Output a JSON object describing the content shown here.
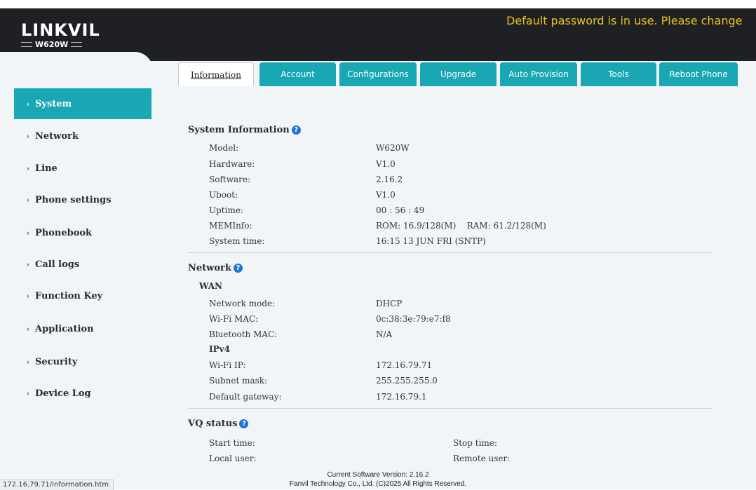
{
  "header": {
    "logo": "LINKVIL",
    "model": "W620W",
    "warning": "Default password is in use. Please change"
  },
  "tabs": [
    "Information",
    "Account",
    "Configurations",
    "Upgrade",
    "Auto Provision",
    "Tools",
    "Reboot Phone"
  ],
  "sidebar": {
    "items": [
      "System",
      "Network",
      "Line",
      "Phone settings",
      "Phonebook",
      "Call logs",
      "Function Key",
      "Application",
      "Security",
      "Device Log"
    ]
  },
  "system_info": {
    "title": "System Information",
    "rows": [
      {
        "label": "Model:",
        "value": "W620W"
      },
      {
        "label": "Hardware:",
        "value": "V1.0"
      },
      {
        "label": "Software:",
        "value": "2.16.2"
      },
      {
        "label": "Uboot:",
        "value": "V1.0"
      },
      {
        "label": "Uptime:",
        "value": "00 : 56 : 49"
      },
      {
        "label": "MEMInfo:",
        "value": "ROM: 16.9/128(M)    RAM: 61.2/128(M)"
      },
      {
        "label": "System time:",
        "value": "16:15 13 JUN FRI (SNTP)"
      }
    ]
  },
  "network": {
    "title": "Network",
    "wan_title": "WAN",
    "rows": [
      {
        "label": "Network mode:",
        "value": "DHCP"
      },
      {
        "label": "Wi-Fi MAC:",
        "value": "0c:38:3e:79:e7:f8"
      },
      {
        "label": "Bluetooth MAC:",
        "value": "N/A"
      }
    ],
    "ipv4_title": "IPv4",
    "ipv4_rows": [
      {
        "label": "Wi-Fi IP:",
        "value": "172.16.79.71"
      },
      {
        "label": "Subnet mask:",
        "value": "255.255.255.0"
      },
      {
        "label": "Default gateway:",
        "value": "172.16.79.1"
      }
    ]
  },
  "vq_status": {
    "title": "VQ status",
    "start_time_label": "Start time:",
    "stop_time_label": "Stop time:",
    "local_user_label": "Local user:",
    "remote_user_label": "Remote user:"
  },
  "footer": {
    "version": "Current Software Version: 2.16.2",
    "copyright": "Fanvil Technology Co., Ltd. (C)2025 All Rights Reserved."
  },
  "status_url": "172.16.79.71/information.htm",
  "colors": {
    "accent": "#18a7b3",
    "header_bg": "#1f2023",
    "warning": "#e8c419",
    "help_icon": "#1f73d9"
  }
}
